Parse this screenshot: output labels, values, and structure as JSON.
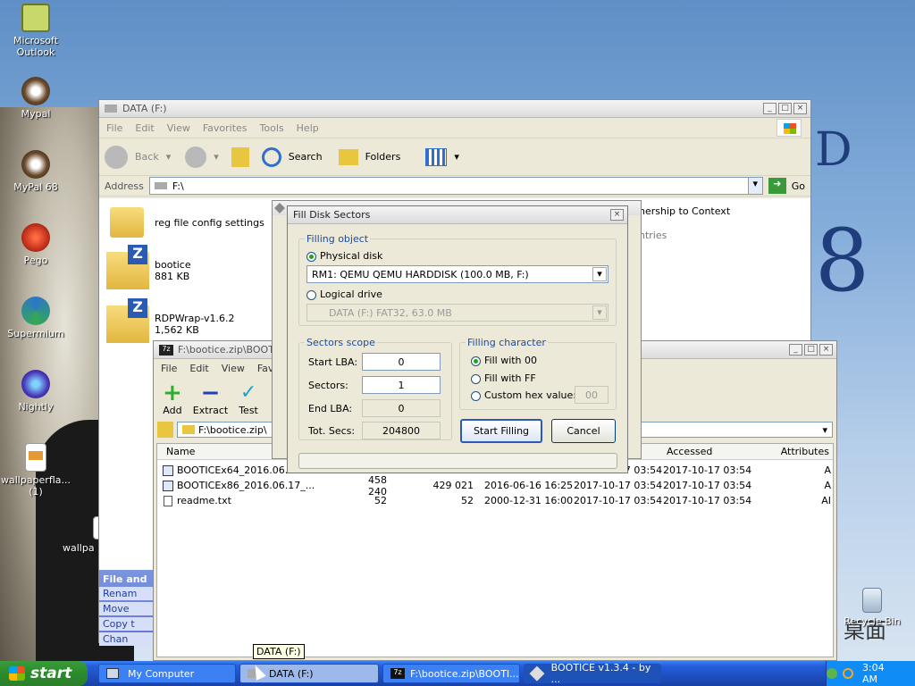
{
  "desktop": {
    "icons": [
      {
        "label": "Microsoft Outlook",
        "icon": "outlook-icon",
        "color": "#c8d86b"
      },
      {
        "label": "Mypal",
        "icon": "mypal-icon",
        "color": "#6b4a2a"
      },
      {
        "label": "MyPal 68",
        "icon": "mypal68-icon",
        "color": "#6b4a2a"
      },
      {
        "label": "Pego",
        "icon": "pego-icon",
        "color": "#c0301b"
      },
      {
        "label": "Supermium",
        "icon": "supermium-icon",
        "color": "#2b77c7"
      },
      {
        "label": "Nightly",
        "icon": "nightly-icon",
        "color": "#4a36b8"
      },
      {
        "label": "wallpaperfla... (1)",
        "icon": "image-file-icon",
        "color": "#e69a37"
      },
      {
        "label": "wallpa",
        "icon": "image-file-icon",
        "color": "#e69a37"
      }
    ],
    "big_letters": [
      "D",
      "8"
    ],
    "recycle_bin": "Recycle Bin",
    "watermark": "桌面"
  },
  "explorer": {
    "title": "DATA (F:)",
    "menu": [
      "File",
      "Edit",
      "View",
      "Favorites",
      "Tools",
      "Help"
    ],
    "back": "Back",
    "search": "Search",
    "folders": "Folders",
    "address_label": "Address",
    "address_value": "F:\\",
    "go": "Go",
    "items": [
      {
        "name": "reg file config settings",
        "size": "",
        "type": "folder"
      },
      {
        "name": "bootice",
        "size": "881 KB",
        "type": "zip"
      },
      {
        "name": "RDPWrap-v1.6.2",
        "size": "1,562 KB",
        "type": "zip"
      }
    ],
    "partial_right_1": "nership to Context",
    "partial_right_2": "ntries",
    "side_panel_title": "File and",
    "side_panel_items": [
      "Renam",
      "Move",
      "Copy t",
      "Chan"
    ]
  },
  "sevenzip": {
    "title": "F:\\bootice.zip\\BOOT",
    "menu": [
      "File",
      "Edit",
      "View",
      "Favo"
    ],
    "tools": [
      "Add",
      "Extract",
      "Test"
    ],
    "path": "F:\\bootice.zip\\",
    "columns": [
      "Name",
      "Accessed",
      "Attributes"
    ],
    "rows": [
      {
        "name": "BOOTICEx64_2016.06.17",
        "size": "",
        "packed": "",
        "modified": "",
        "created": "2017-10-17 03:54",
        "accessed": "2017-10-17 03:54",
        "attr": "A"
      },
      {
        "name": "BOOTICEx86_2016.06.17_...",
        "size": "458 240",
        "packed": "429 021",
        "modified": "2016-06-16 16:25",
        "created": "2017-10-17 03:54",
        "accessed": "2017-10-17 03:54",
        "attr": "A"
      },
      {
        "name": "readme.txt",
        "size": "52",
        "packed": "52",
        "modified": "2000-12-31 16:00",
        "created": "2017-10-17 03:54",
        "accessed": "2017-10-17 03:54",
        "attr": "AI"
      }
    ],
    "partial_h": "h"
  },
  "dialog": {
    "title": "Fill Disk Sectors",
    "filling_object": "Filling object",
    "physical_disk": "Physical disk",
    "physical_disk_selected": true,
    "disk_select": "RM1: QEMU QEMU HARDDISK (100.0 MB, F:)",
    "logical_drive": "Logical drive",
    "logical_select": "DATA (F:)  FAT32,  63.0 MB",
    "sectors_scope": "Sectors scope",
    "start_lba_label": "Start LBA:",
    "start_lba": "0",
    "sectors_label": "Sectors:",
    "sectors": "1",
    "end_lba_label": "End LBA:",
    "end_lba": "0",
    "tot_secs_label": "Tot. Secs:",
    "tot_secs": "204800",
    "filling_character": "Filling character",
    "fill_00": "Fill with 00",
    "fill_ff": "Fill with FF",
    "custom_hex": "Custom hex value:",
    "custom_hex_value": "00",
    "start_button": "Start Filling",
    "cancel_button": "Cancel"
  },
  "tooltip": "DATA (F:)",
  "taskbar": {
    "start": "start",
    "tasks": [
      "My Computer",
      "DATA (F:)",
      "F:\\bootice.zip\\BOOTI...",
      "BOOTICE v1.3.4 - by ..."
    ],
    "clock": "3:04 AM"
  },
  "colors": {
    "taskbar": "#245edb",
    "start": "#2a8b2a",
    "dialog_bg": "#ece9d8",
    "accent_blue": "#1f4b99"
  }
}
